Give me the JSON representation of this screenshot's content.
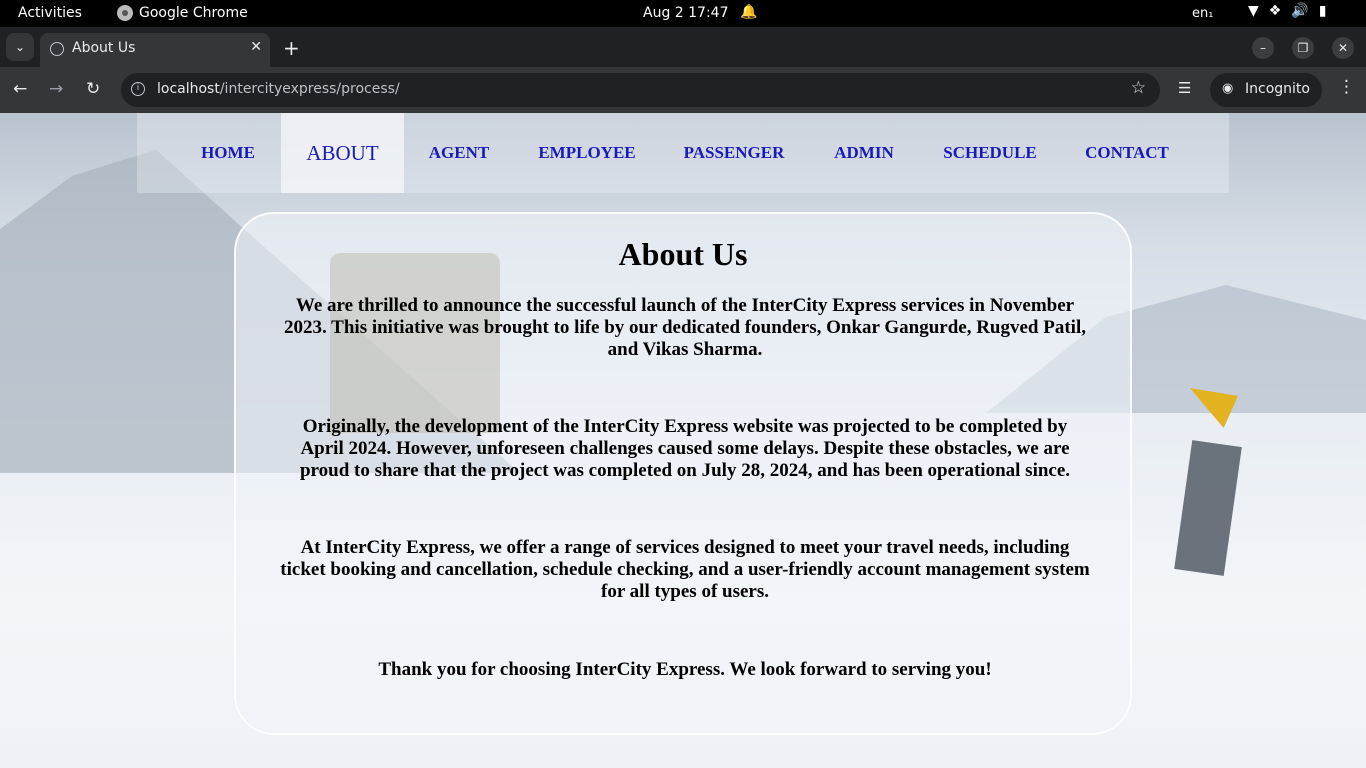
{
  "system_bar": {
    "activities": "Activities",
    "app_name": "Google Chrome",
    "clock": "Aug 2  17:47",
    "language": "en₁"
  },
  "browser": {
    "tab_title": "About Us",
    "url_host": "localhost",
    "url_path": "/intercityexpress/process/",
    "incognito_label": "Incognito"
  },
  "nav": {
    "items": [
      {
        "label": "HOME"
      },
      {
        "label": "ABOUT"
      },
      {
        "label": "AGENT"
      },
      {
        "label": "EMPLOYEE"
      },
      {
        "label": "PASSENGER"
      },
      {
        "label": "ADMIN"
      },
      {
        "label": "SCHEDULE"
      },
      {
        "label": "CONTACT"
      }
    ],
    "active_item": "ABOUT"
  },
  "about": {
    "heading": "About Us",
    "paragraphs": [
      "We are thrilled to announce the successful launch of the InterCity Express services in November 2023. This initiative was brought to life by our dedicated founders, Onkar Gangurde, Rugved Patil, and Vikas Sharma.",
      "Originally, the development of the InterCity Express website was projected to be completed by April 2024. However, unforeseen challenges caused some delays. Despite these obstacles, we are proud to share that the project was completed on July 28, 2024, and has been operational since.",
      "At InterCity Express, we offer a range of services designed to meet your travel needs, including ticket booking and cancellation, schedule checking, and a user-friendly account management system for all types of users.",
      "Thank you for choosing InterCity Express. We look forward to serving you!"
    ]
  },
  "colors": {
    "nav_link": "#1a1ab8",
    "browser_frame": "#202124",
    "toolbar": "#35363a"
  }
}
